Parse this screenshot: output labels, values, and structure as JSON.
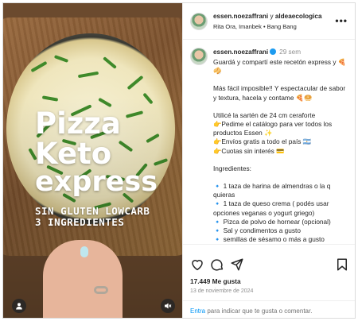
{
  "media": {
    "title_line1": "Pizza",
    "title_line2": "Keto",
    "title_line3": "express",
    "subtitle_line1": "SIN GLUTEN LOWCARB",
    "subtitle_line2": "3 INGREDIENTES",
    "user_tag_icon": "person-icon",
    "mute_icon": "muted-speaker-icon"
  },
  "header": {
    "username": "essen.noezaffrani",
    "joiner": "y",
    "collaborator": "aldeaecologica",
    "audio": "Rita Ora, Imanbek • Bang Bang",
    "more_icon": "more-options-icon"
  },
  "post": {
    "username": "essen.noezaffrani",
    "time": "29 sem",
    "caption_lines": [
      "Guardá y compartí este recetón express y 🍕🥠",
      "",
      "Más fácil imposible!! Y espectacular de sabor y textura, hacela y contame 🍕🥯",
      "",
      "Utilicé la sartén de 24 cm ceraforte",
      "👉Pedime el catálogo para ver todos los productos Essen ✨",
      "👉Envíos gratis a todo el país 🇦🇷",
      "👉Cuotas sin interés 💳",
      "",
      "Ingredientes:",
      "",
      "🔹 1 taza de harina de almendras o la q quieras",
      "🔹 1 taza de queso crema ( podés usar opciones veganas o yogurt griego)",
      "🔹 Pizca de polvo de hornear (opcional)",
      "🔹 Sal y condimentos a gusto",
      "🔹 semillas de sésamo o más a gusto"
    ]
  },
  "actions": {
    "like_icon": "heart-icon",
    "comment_icon": "comment-icon",
    "share_icon": "send-icon",
    "save_icon": "bookmark-icon",
    "likes": "17.449 Me gusta",
    "date": "13 de noviembre de 2024"
  },
  "comment_bar": {
    "login_link": "Entra",
    "text": " para indicar que te gusta o comentar."
  }
}
